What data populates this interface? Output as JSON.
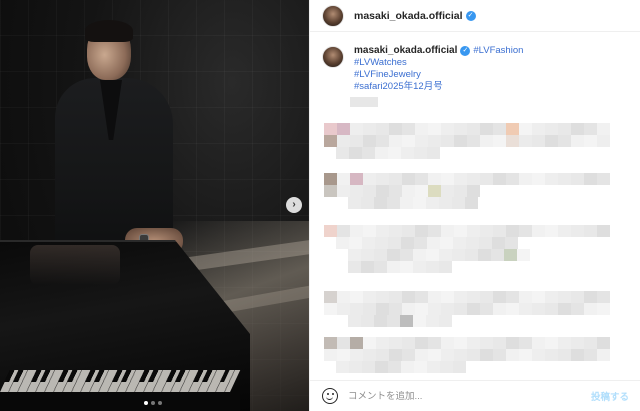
{
  "post": {
    "username": "masaki_okada.official",
    "verified": true,
    "carousel": {
      "current_slide": 1,
      "total_slides": 3
    }
  },
  "header": {
    "username": "masaki_okada.official"
  },
  "caption": {
    "username": "masaki_okada.official",
    "hashtags": [
      "#LVFashion",
      "#LVWatches",
      "#LVFineJewelry",
      "#safari2025年12月号"
    ]
  },
  "icons": {
    "verified": "verified-badge-icon",
    "next": "chevron-right-icon",
    "emoji": "emoji-icon"
  },
  "footer": {
    "comment_placeholder": "コメントを追加...",
    "post_label": "投稿する"
  },
  "colors": {
    "link": "#3b6fd1",
    "verified": "#3897f0",
    "post_disabled": "#b2dffc"
  }
}
